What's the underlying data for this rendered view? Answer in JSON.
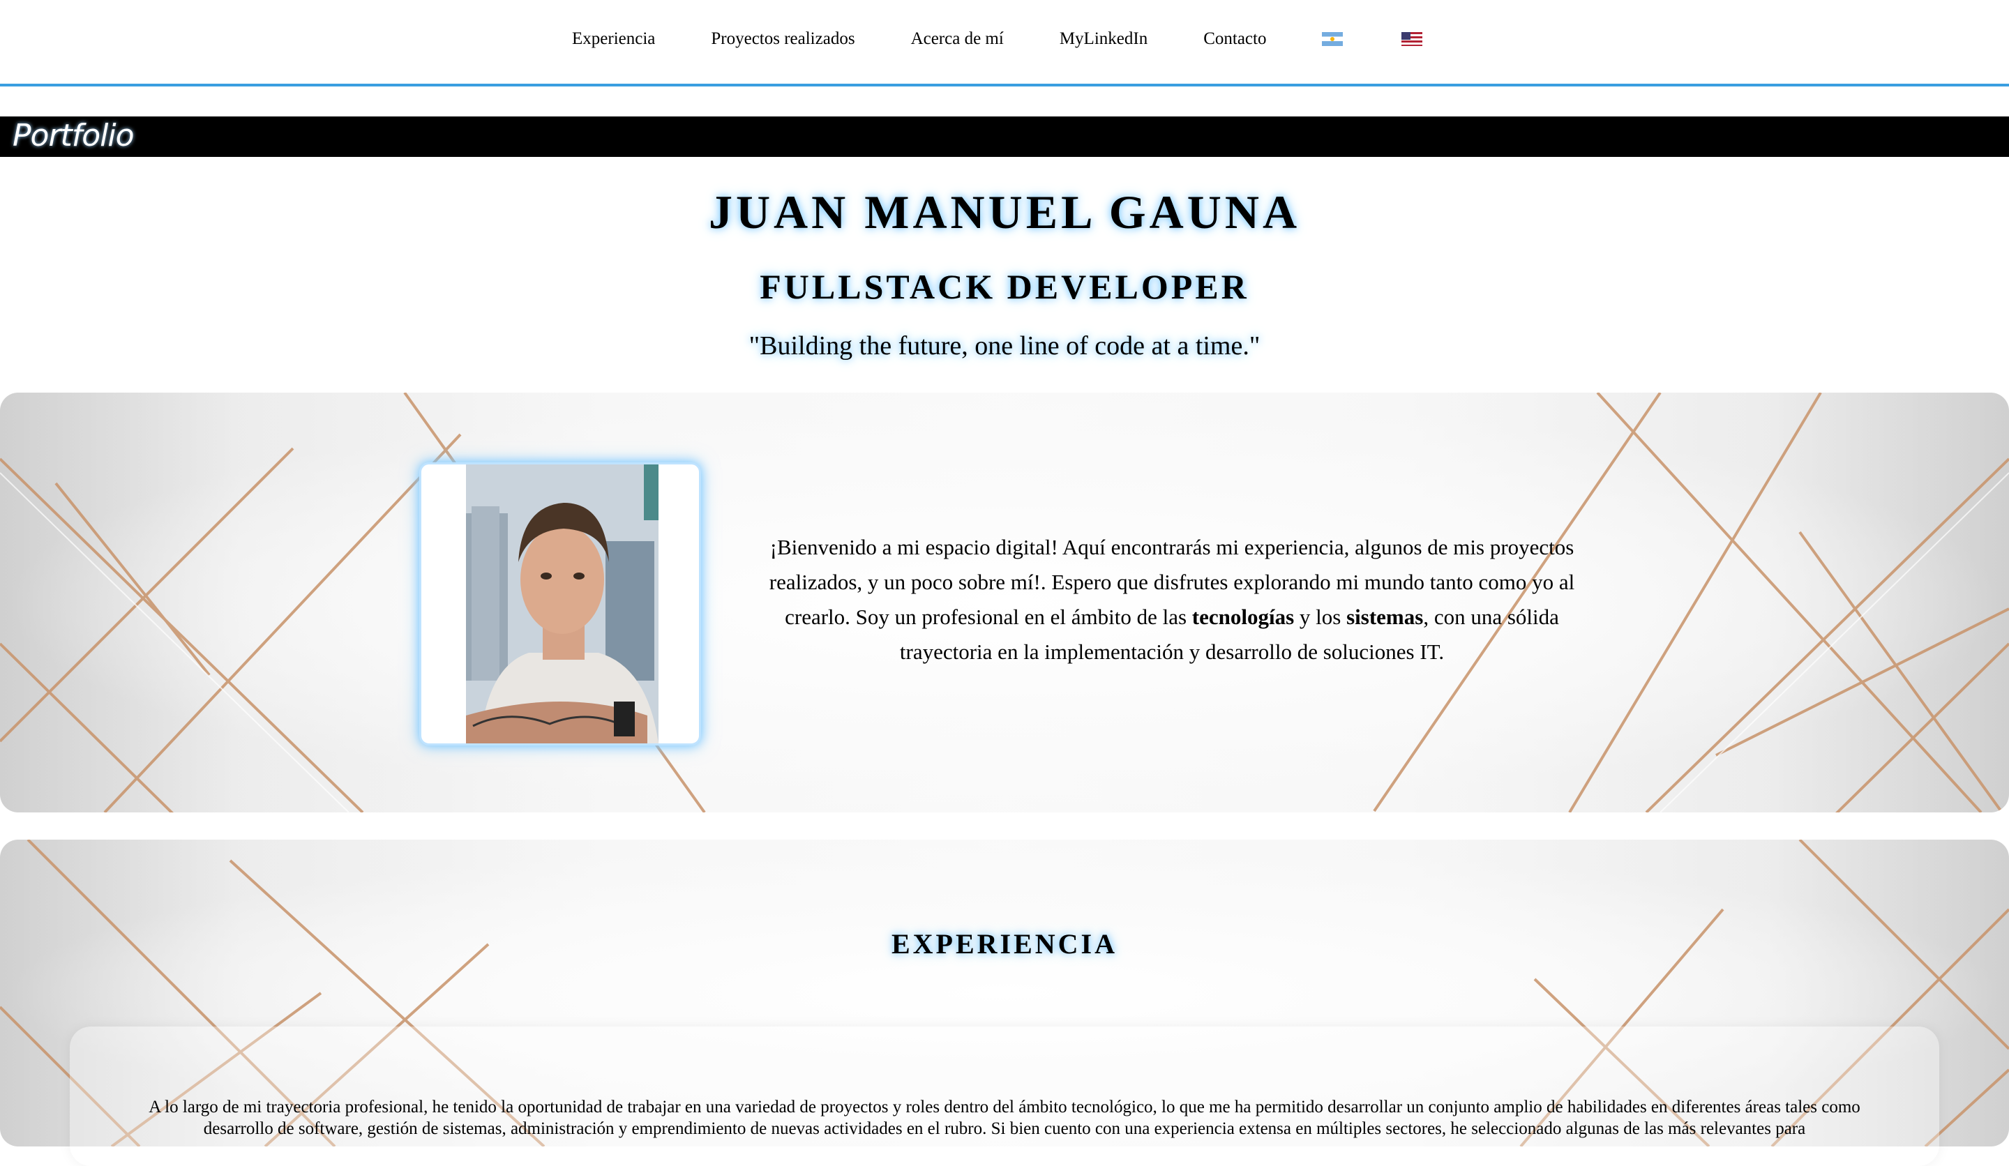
{
  "nav": {
    "items": [
      {
        "label": "Experiencia"
      },
      {
        "label": "Proyectos realizados"
      },
      {
        "label": "Acerca de mí"
      },
      {
        "label": "MyLinkedIn"
      },
      {
        "label": "Contacto"
      }
    ],
    "flags": [
      "flag-argentina-icon",
      "flag-usa-icon"
    ]
  },
  "brand": "Portfolio",
  "hero": {
    "name": "JUAN MANUEL GAUNA",
    "role": "FULLSTACK DEVELOPER",
    "quote": "\"Building the future, one line of code at a time.\""
  },
  "about": {
    "intro": "¡Bienvenido a mi espacio digital! Aquí encontrarás mi experiencia, algunos de mis proyectos realizados, y un poco sobre mí!. Espero que disfrutes explorando mi mundo tanto como yo al crearlo. Soy un profesional en el ámbito de las ",
    "kw1": "tecnologías",
    "mid": " y los ",
    "kw2": "sistemas",
    "outro": ", con una sólida trayectoria en la implementación y desarrollo de soluciones IT."
  },
  "experience": {
    "title": "EXPERIENCIA",
    "text": "A lo largo de mi trayectoria profesional, he tenido la oportunidad de trabajar en una variedad de proyectos y roles dentro del ámbito tecnológico, lo que me ha permitido desarrollar un conjunto amplio de habilidades en diferentes áreas tales como desarrollo de software, gestión de sistemas, administración y emprendimiento de nuevas actividades en el rubro. Si bien cuento con una experiencia extensa en múltiples sectores, he seleccionado algunas de las más relevantes para"
  },
  "colors": {
    "accent": "#3a9ee0",
    "glow": "#7ec9ff",
    "brand_bar": "#000000",
    "stripe_gold": "#c8936a"
  }
}
